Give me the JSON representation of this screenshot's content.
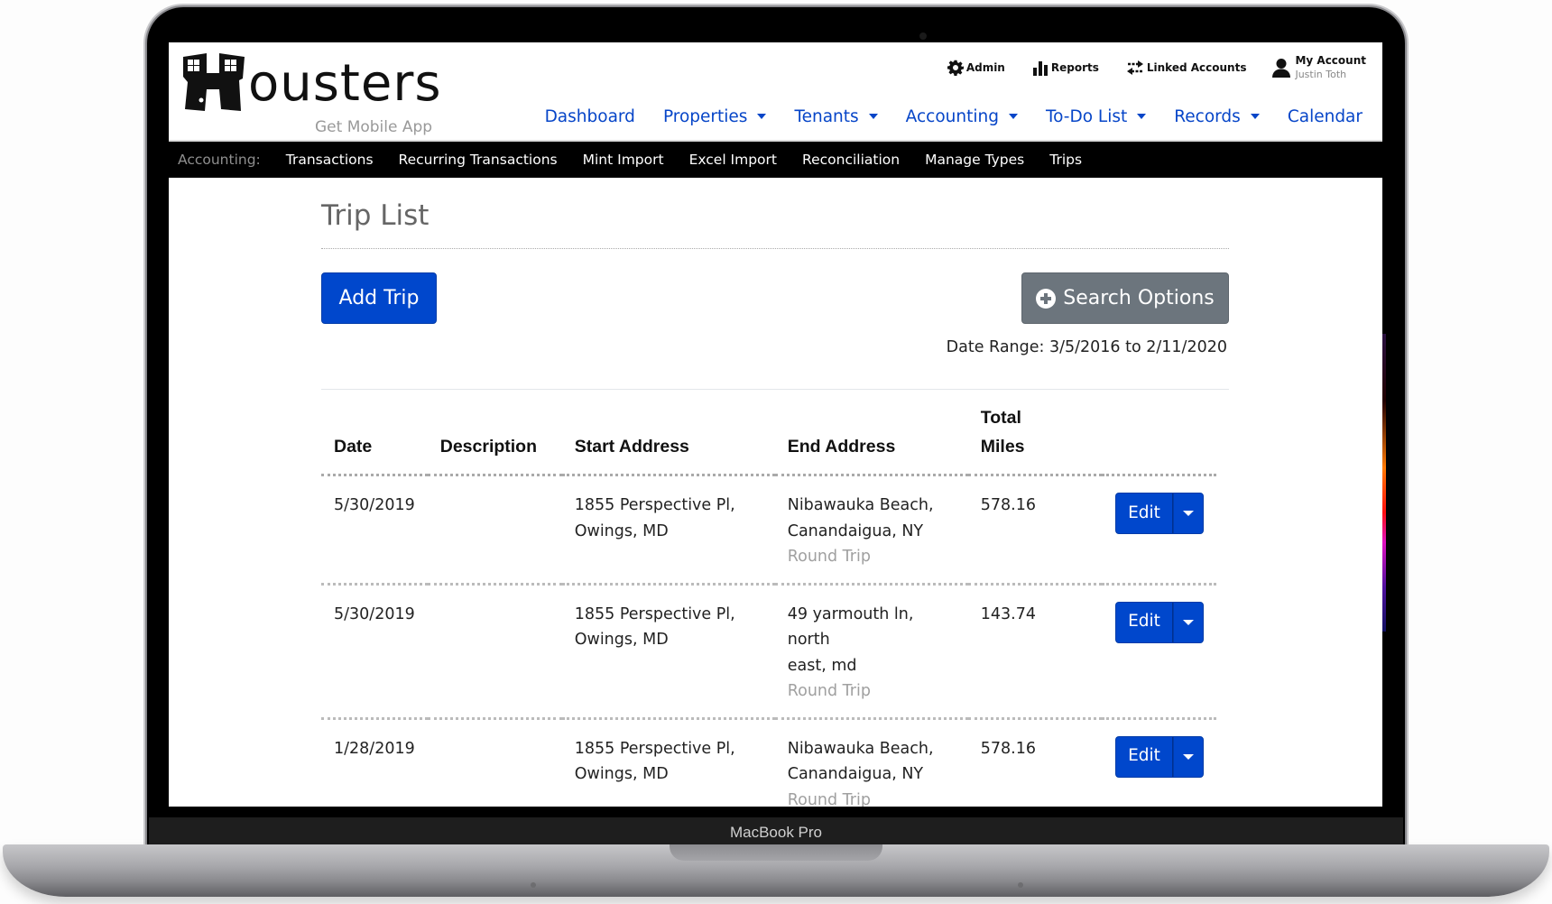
{
  "device": {
    "label": "MacBook Pro"
  },
  "header": {
    "brand": "ousters",
    "mobile_link": "Get Mobile App",
    "utility_nav": [
      {
        "label": "Admin",
        "icon": "gear-icon"
      },
      {
        "label": "Reports",
        "icon": "bar-chart-icon"
      },
      {
        "label": "Linked Accounts",
        "icon": "exchange-arrows-icon"
      }
    ],
    "account": {
      "label": "My Account",
      "user": "Justin Toth",
      "icon": "user-icon"
    },
    "main_nav": [
      {
        "label": "Dashboard",
        "dropdown": false
      },
      {
        "label": "Properties",
        "dropdown": true
      },
      {
        "label": "Tenants",
        "dropdown": true
      },
      {
        "label": "Accounting",
        "dropdown": true
      },
      {
        "label": "To-Do List",
        "dropdown": true
      },
      {
        "label": "Records",
        "dropdown": true
      },
      {
        "label": "Calendar",
        "dropdown": false
      }
    ]
  },
  "subnav": {
    "section_label": "Accounting:",
    "items": [
      "Transactions",
      "Recurring Transactions",
      "Mint Import",
      "Excel Import",
      "Reconciliation",
      "Manage Types",
      "Trips"
    ]
  },
  "page": {
    "title": "Trip List",
    "add_button": "Add Trip",
    "search_button": "Search Options",
    "date_range": "Date Range: 3/5/2016 to 2/11/2020"
  },
  "table": {
    "headers": {
      "date": "Date",
      "description": "Description",
      "start": "Start Address",
      "end": "End Address",
      "miles_line1": "Total",
      "miles_line2": "Miles"
    },
    "rows": [
      {
        "date": "5/30/2019",
        "description": "",
        "start_line1": "1855 Perspective Pl,",
        "start_line2": "Owings, MD",
        "end_line1": "Nibawauka Beach,",
        "end_line2": "Canandaigua, NY",
        "trip_type": "Round Trip",
        "miles": "578.16",
        "edit": "Edit"
      },
      {
        "date": "5/30/2019",
        "description": "",
        "start_line1": "1855 Perspective Pl,",
        "start_line2": "Owings, MD",
        "end_line1": "49 yarmouth ln, north",
        "end_line2": "east, md",
        "trip_type": "Round Trip",
        "miles": "143.74",
        "edit": "Edit"
      },
      {
        "date": "1/28/2019",
        "description": "",
        "start_line1": "1855 Perspective Pl,",
        "start_line2": "Owings, MD",
        "end_line1": "Nibawauka Beach,",
        "end_line2": "Canandaigua, NY",
        "trip_type": "Round Trip",
        "miles": "578.16",
        "edit": "Edit"
      }
    ]
  },
  "colors": {
    "primary": "#0047cc",
    "secondary": "#6c757d",
    "nav_link": "#0645c8",
    "subnav_bg": "#000000"
  }
}
